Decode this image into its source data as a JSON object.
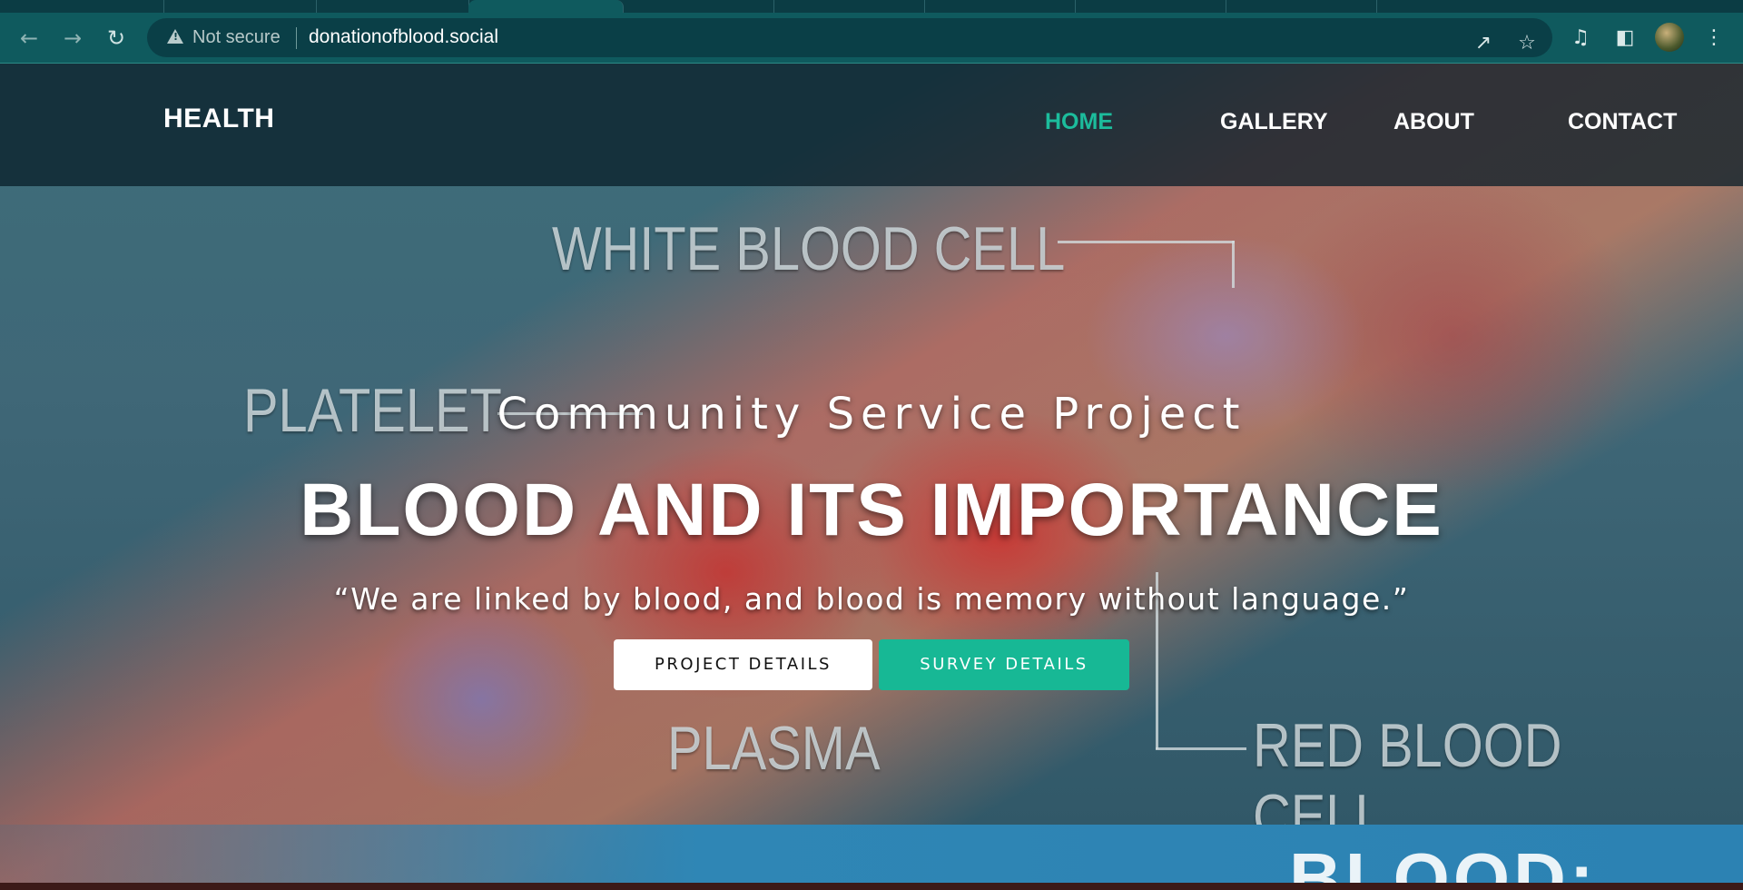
{
  "browser": {
    "security_label": "Not secure",
    "url": "donationofblood.social",
    "icons": [
      "back-arrow-icon",
      "forward-arrow-icon",
      "reload-icon",
      "warning-icon",
      "share-icon",
      "star-icon",
      "media-icon",
      "sidepanel-icon",
      "profile-avatar",
      "kebab-menu-icon"
    ]
  },
  "site": {
    "brand": "HEALTH",
    "nav": {
      "home": "HOME",
      "gallery": "GALLERY",
      "about": "ABOUT",
      "contact": "CONTACT"
    },
    "accent_color": "#1cbc9c"
  },
  "hero": {
    "image_labels": {
      "white_blood_cell": "WHITE BLOOD CELL",
      "platelet": "PLATELET",
      "plasma": "PLASMA",
      "red_blood_cell": "RED BLOOD CELL"
    },
    "subtitle": "Community Service Project",
    "headline": "BLOOD AND ITS IMPORTANCE",
    "quote": "“We are linked by blood, and blood is memory without language.”",
    "buttons": {
      "project": "PROJECT DETAILS",
      "survey": "SURVEY DETAILS"
    }
  },
  "next_section": {
    "partial_heading": "BLOOD:"
  }
}
